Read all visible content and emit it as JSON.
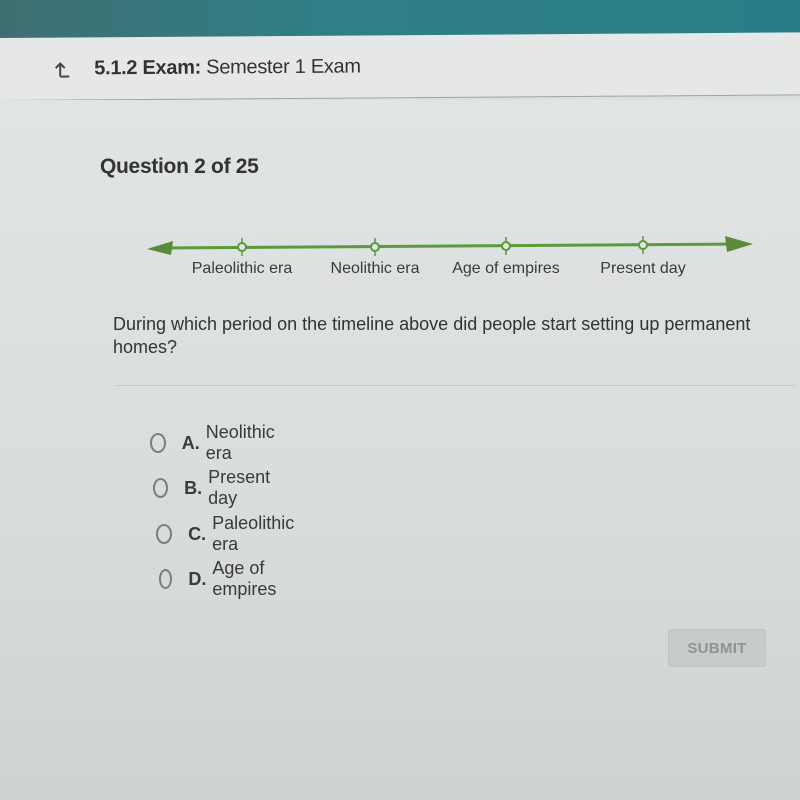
{
  "header": {
    "back_icon": "up-arrow-icon",
    "course_code": "5.1.2",
    "exam_label": "Exam:",
    "exam_name": "Semester 1 Exam"
  },
  "question": {
    "number_label": "Question 2 of 25",
    "text": "During which period on the timeline above did people start setting up permanent homes?"
  },
  "timeline": {
    "color": "#5a9a3a",
    "points": [
      {
        "label": "Paleolithic era"
      },
      {
        "label": "Neolithic era"
      },
      {
        "label": "Age of empires"
      },
      {
        "label": "Present day"
      }
    ]
  },
  "options": [
    {
      "letter": "A.",
      "text": "Neolithic era",
      "selected": false
    },
    {
      "letter": "B.",
      "text": "Present day",
      "selected": false
    },
    {
      "letter": "C.",
      "text": "Paleolithic era",
      "selected": false
    },
    {
      "letter": "D.",
      "text": "Age of empires",
      "selected": false
    }
  ],
  "submit": {
    "label": "SUBMIT",
    "enabled": false
  }
}
